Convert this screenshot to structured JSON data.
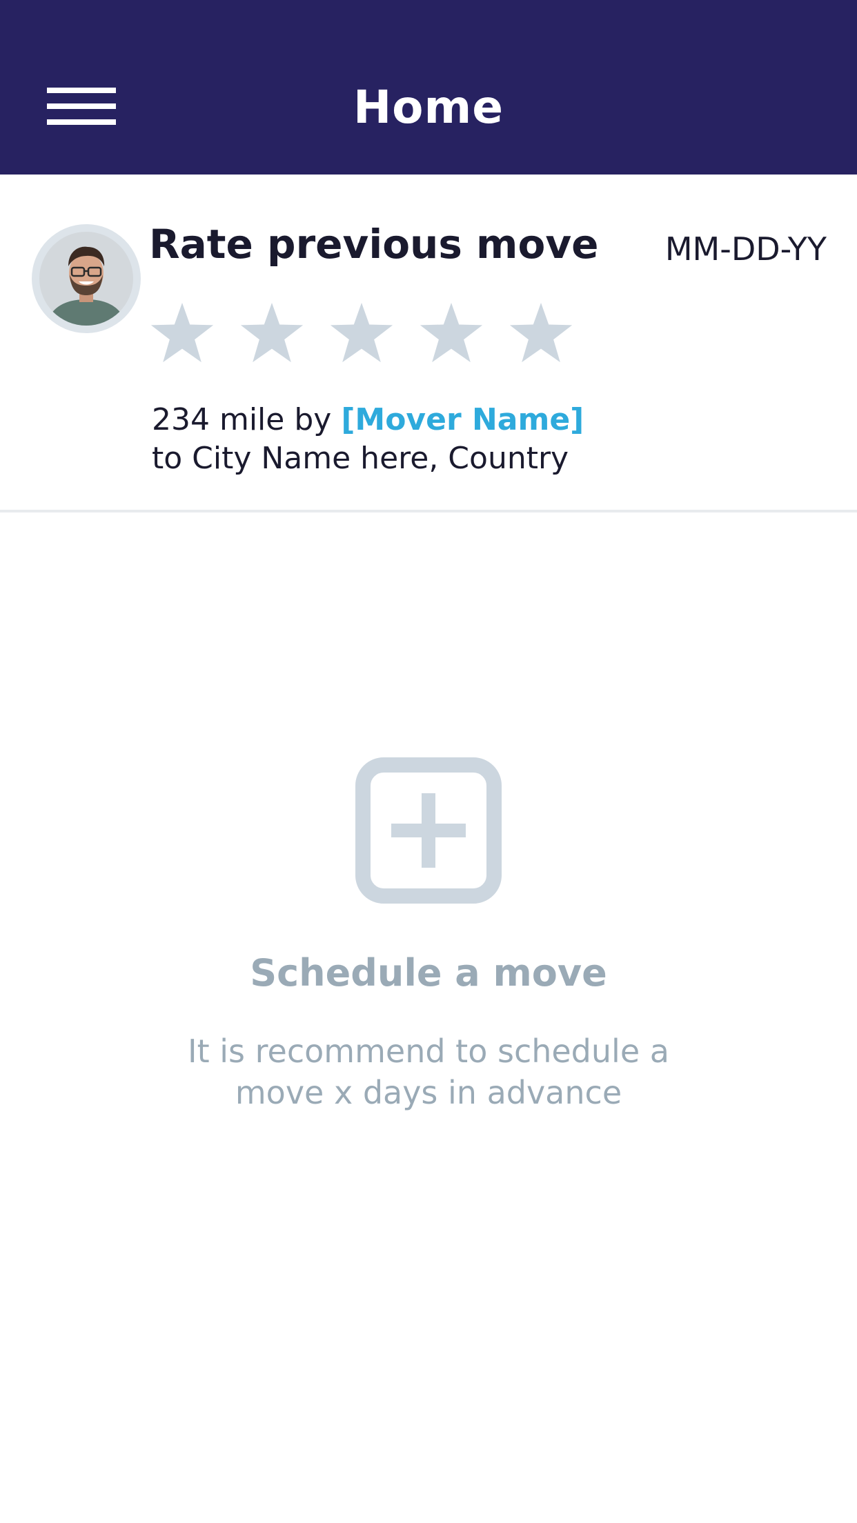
{
  "header": {
    "title": "Home",
    "menu_icon": "hamburger-menu-icon",
    "background_color": "#272261"
  },
  "rate_card": {
    "title": "Rate previous move",
    "date": "MM-DD-YY",
    "avatar_icon": "user-avatar",
    "rating": {
      "value": 0,
      "max": 5,
      "star_color": "#ccd6df"
    },
    "distance_text": "234 mile by",
    "mover_name": "[Mover Name]",
    "destination_text": "to City Name here, Country",
    "link_color": "#2eaadc"
  },
  "schedule": {
    "icon": "plus-square-icon",
    "title": "Schedule a move",
    "description": "It is recommend to schedule a move x days in advance",
    "text_color": "#9aaab6"
  }
}
